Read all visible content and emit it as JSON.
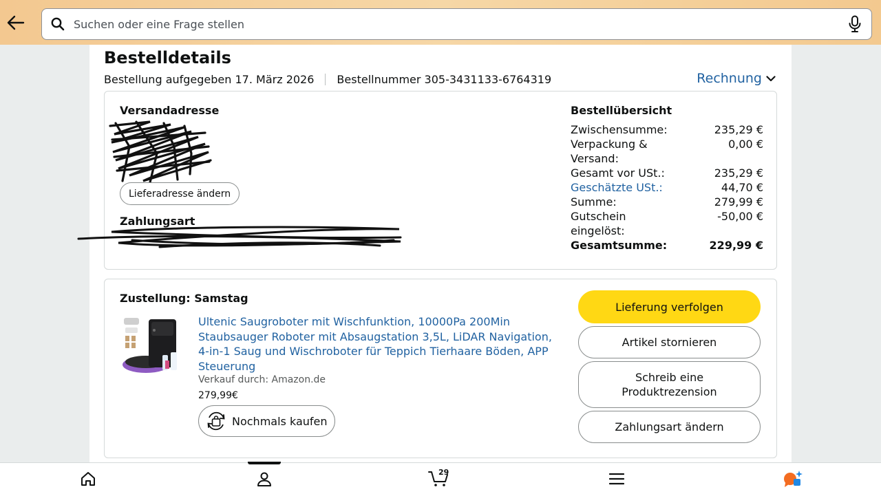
{
  "header": {
    "search_placeholder": "Suchen oder eine Frage stellen"
  },
  "page": {
    "title": "Bestelldetails",
    "order_placed": "Bestellung aufgegeben 17. März 2026",
    "order_number": "Bestellnummer 305-3431133-6764319",
    "invoice_label": "Rechnung"
  },
  "shipping": {
    "label": "Versandadresse",
    "change_button": "Lieferadresse ändern"
  },
  "payment": {
    "label": "Zahlungsart"
  },
  "summary": {
    "title": "Bestellübersicht",
    "rows": [
      {
        "label": "Zwischensumme:",
        "value": "235,29 €"
      },
      {
        "label": "Verpackung & Versand:",
        "value": "0,00 €"
      },
      {
        "label": "Gesamt vor USt.:",
        "value": "235,29 €"
      },
      {
        "label": "Geschätzte USt.:",
        "value": "44,70 €"
      },
      {
        "label": "Summe:",
        "value": "279,99 €"
      },
      {
        "label": "Gutschein eingelöst:",
        "value": "-50,00 €"
      },
      {
        "label": "Gesamtsumme:",
        "value": "229,99 €"
      }
    ]
  },
  "delivery": {
    "label": "Zustellung: Samstag",
    "product_title": "Ultenic Saugroboter mit Wischfunktion, 10000Pa 200Min Staubsauger Roboter mit Absaugstation 3,5L, LiDAR Navigation, 4-in-1 Saug und Wischroboter für Teppich Tierhaare Böden, APP Steuerung",
    "seller": "Verkauf durch: Amazon.de",
    "price": "279,99€",
    "buy_again": "Nochmals kaufen",
    "actions": {
      "track": "Lieferung verfolgen",
      "cancel": "Artikel stornieren",
      "review": "Schreib eine Produktrezension",
      "change_payment": "Zahlungsart ändern"
    }
  },
  "bottom_nav": {
    "cart_count": "29"
  },
  "colors": {
    "link": "#2162a1",
    "primary_button": "#ffd814",
    "header_bg": "#f3c890"
  }
}
